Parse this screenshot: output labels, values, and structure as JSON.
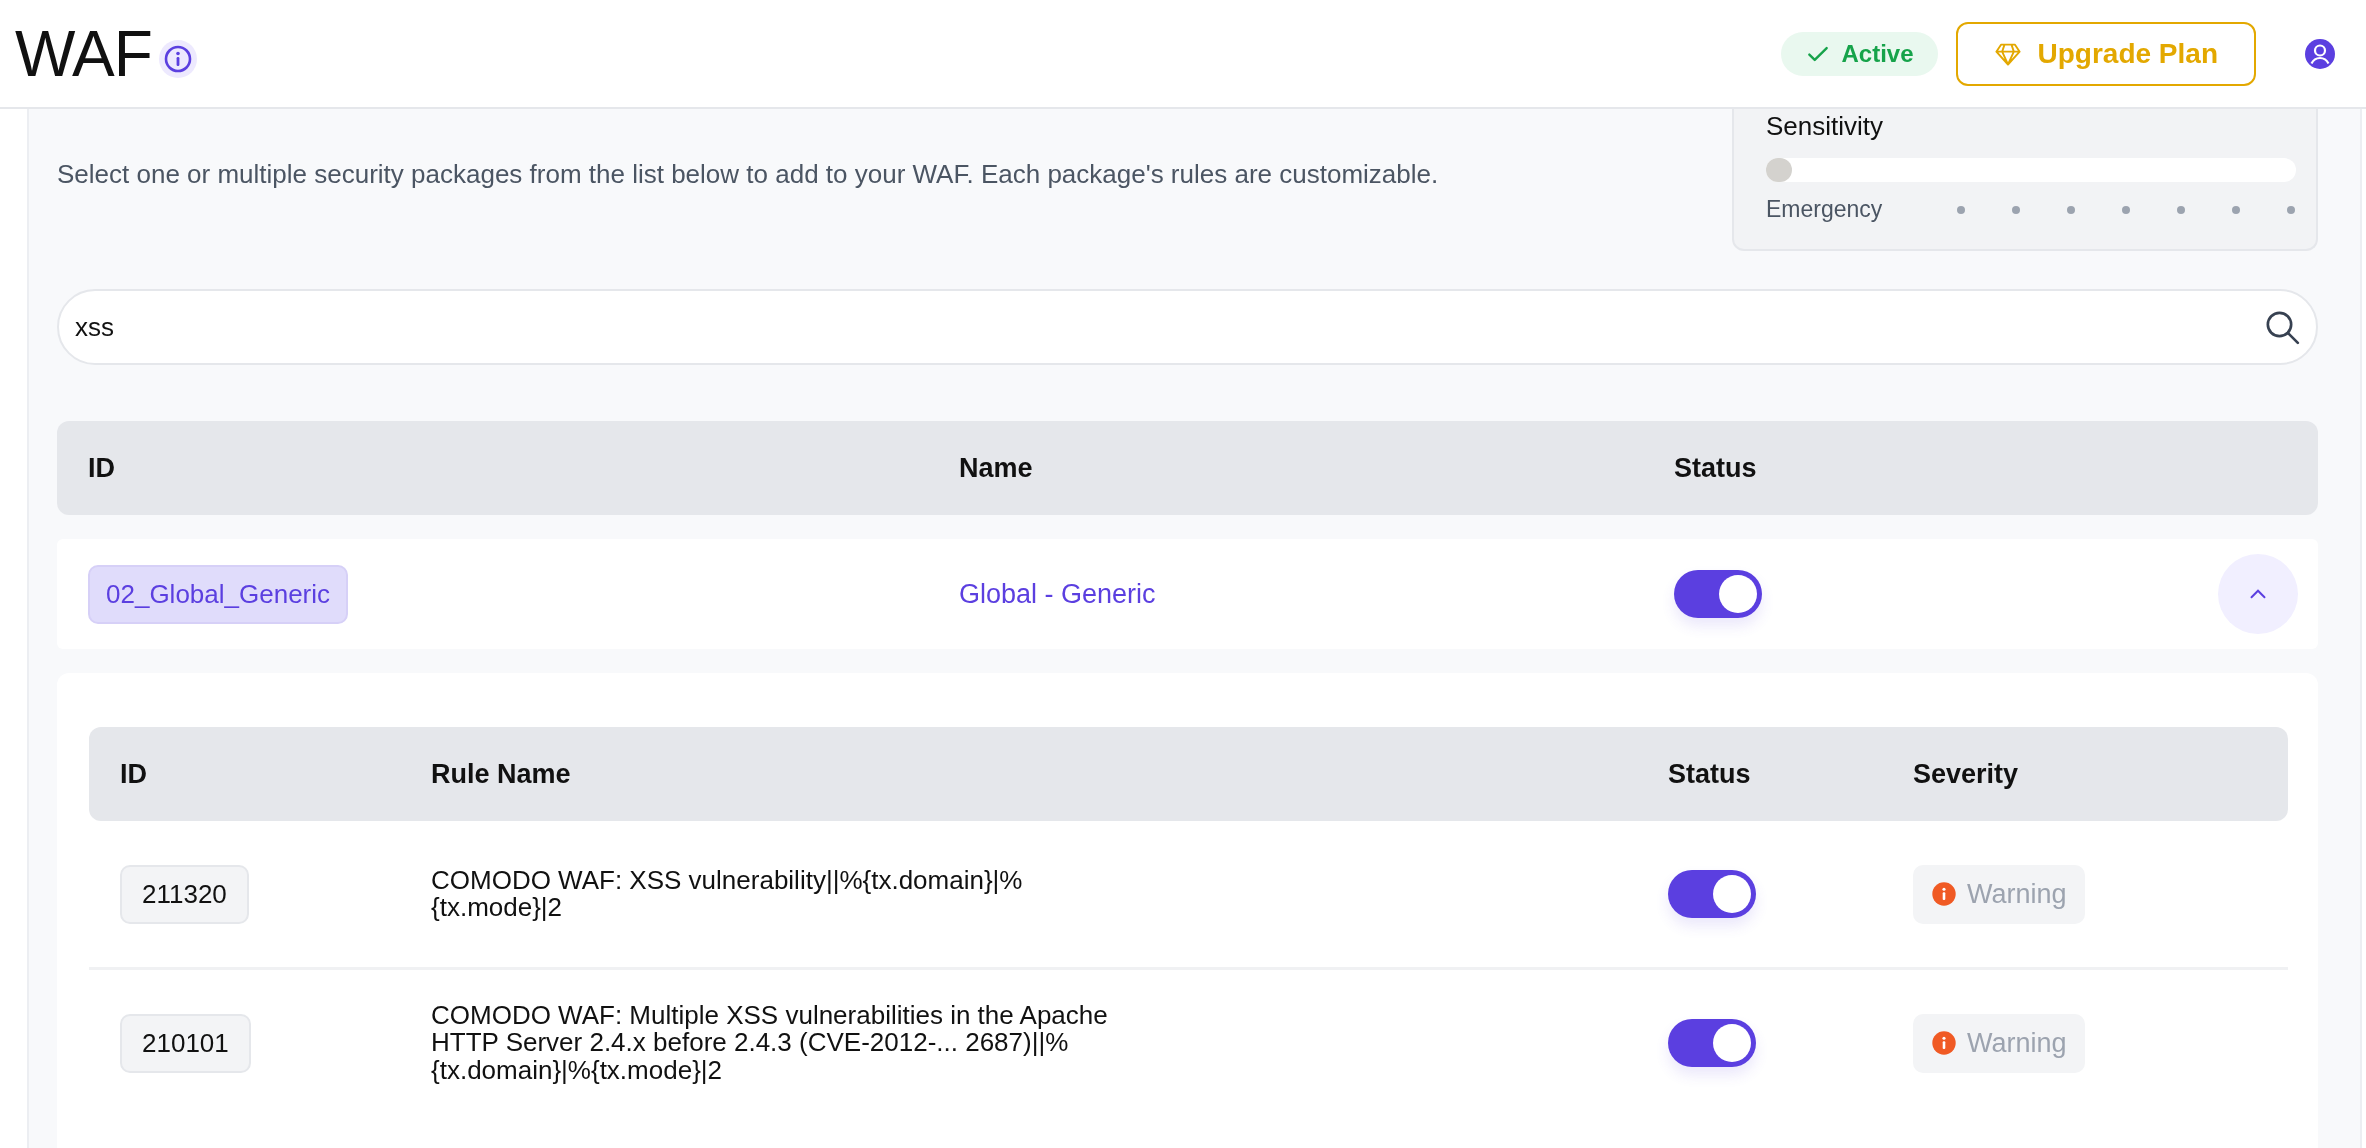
{
  "header": {
    "title": "WAF",
    "status": "Active",
    "upgrade_button": "Upgrade Plan"
  },
  "description": "Select one or multiple security packages from the list below to add to your WAF. Each package's rules are customizable.",
  "sensitivity": {
    "title": "Sensitivity",
    "level": 0,
    "label": "Emergency"
  },
  "search": {
    "value": "xss"
  },
  "packages": {
    "columns": [
      "ID",
      "Name",
      "Status"
    ],
    "rows": [
      {
        "id": "02_Global_Generic",
        "name": "Global - Generic",
        "on": true,
        "expanded": true,
        "rules": {
          "columns": [
            "ID",
            "Rule Name",
            "Status",
            "Severity"
          ],
          "rows": [
            {
              "id": "211320",
              "name": "COMODO WAF: XSS vulnerability||%{tx.domain}|%{tx.mode}|2",
              "on": true,
              "severity": "Warning"
            },
            {
              "id": "210101",
              "name": "COMODO WAF: Multiple XSS vulnerabilities in the Apache HTTP Server 2.4.x before 2.4.3 (CVE-2012-... 2687)||%{tx.domain}|%{tx.mode}|2",
              "on": true,
              "severity": "Warning"
            }
          ]
        }
      }
    ]
  }
}
